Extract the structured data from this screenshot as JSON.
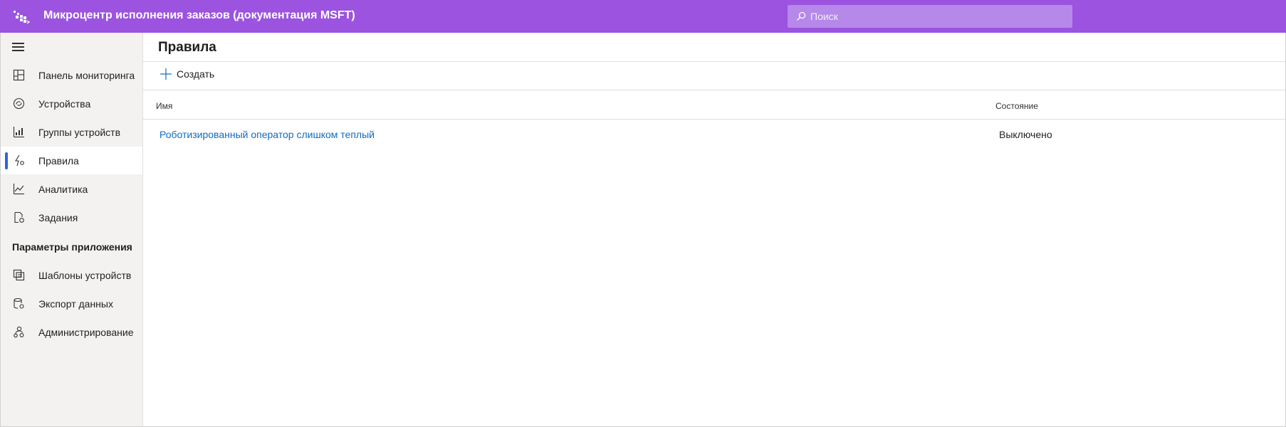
{
  "header": {
    "app_title": "Микроцентр исполнения заказов (документация MSFT)",
    "search_placeholder": "Поиск",
    "search_icon": "search-icon",
    "logo_icon": "app-logo-icon"
  },
  "sidebar": {
    "menu_icon": "hamburger-menu-icon",
    "items": [
      {
        "label": "Панель мониторинга",
        "icon": "dashboard-icon"
      },
      {
        "label": "Устройства",
        "icon": "devices-icon"
      },
      {
        "label": "Группы устройств",
        "icon": "device-groups-icon"
      },
      {
        "label": "Правила",
        "icon": "rules-icon",
        "active": true
      },
      {
        "label": "Аналитика",
        "icon": "analytics-icon"
      },
      {
        "label": "Задания",
        "icon": "jobs-icon"
      }
    ],
    "section_title": "Параметры приложения",
    "settings_items": [
      {
        "label": "Шаблоны устройств",
        "icon": "device-templates-icon"
      },
      {
        "label": "Экспорт данных",
        "icon": "data-export-icon"
      },
      {
        "label": "Администрирование",
        "icon": "administration-icon"
      }
    ]
  },
  "main": {
    "page_title": "Правила",
    "commands": {
      "new_label": "Создать",
      "new_icon": "plus-icon"
    },
    "table": {
      "columns": [
        "Имя",
        "Состояние"
      ],
      "rows": [
        {
          "name": "Роботизированный оператор слишком теплый",
          "status": "Выключено"
        }
      ]
    }
  },
  "colors": {
    "header_bg": "#9b53e0",
    "accent": "#2f66d4",
    "link": "#0f6cbd",
    "sidebar_bg": "#f3f2f1"
  }
}
